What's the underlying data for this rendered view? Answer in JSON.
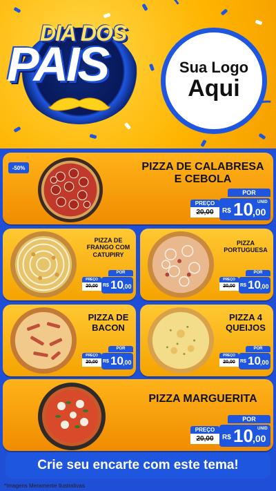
{
  "hero": {
    "title_top": "DIA DOS",
    "title_main": "PAIS",
    "logo_line1": "Sua Logo",
    "logo_line2": "Aqui"
  },
  "price_labels": {
    "por": "POR",
    "preco": "PREÇO",
    "currency": "R$",
    "unit": "UNID"
  },
  "items": [
    {
      "name": "PIZZA DE CALABRESA E CEBOLA",
      "discount": "-50%",
      "old_price": "20,00",
      "price_int": "10",
      "price_dec": ",00"
    },
    {
      "name": "PIZZA DE FRANGO COM CATUPIRY",
      "old_price": "20,00",
      "price_int": "10",
      "price_dec": ",00"
    },
    {
      "name": "PIZZA PORTUGUESA",
      "old_price": "20,00",
      "price_int": "10",
      "price_dec": ",00"
    },
    {
      "name": "PIZZA DE BACON",
      "old_price": "20,00",
      "price_int": "10",
      "price_dec": ",00"
    },
    {
      "name": "PIZZA 4 QUEIJOS",
      "old_price": "20,00",
      "price_int": "10",
      "price_dec": ",00"
    },
    {
      "name": "PIZZA MARGUERITA",
      "old_price": "20,00",
      "price_int": "10",
      "price_dec": ",00"
    }
  ],
  "footer": {
    "cta": "Crie seu encarte com este tema!",
    "note": "*Imagens Meramente Ilustrativas"
  },
  "colors": {
    "blue": "#1e56e0",
    "orange": "#f08c00",
    "yellow": "#ffc21a"
  }
}
